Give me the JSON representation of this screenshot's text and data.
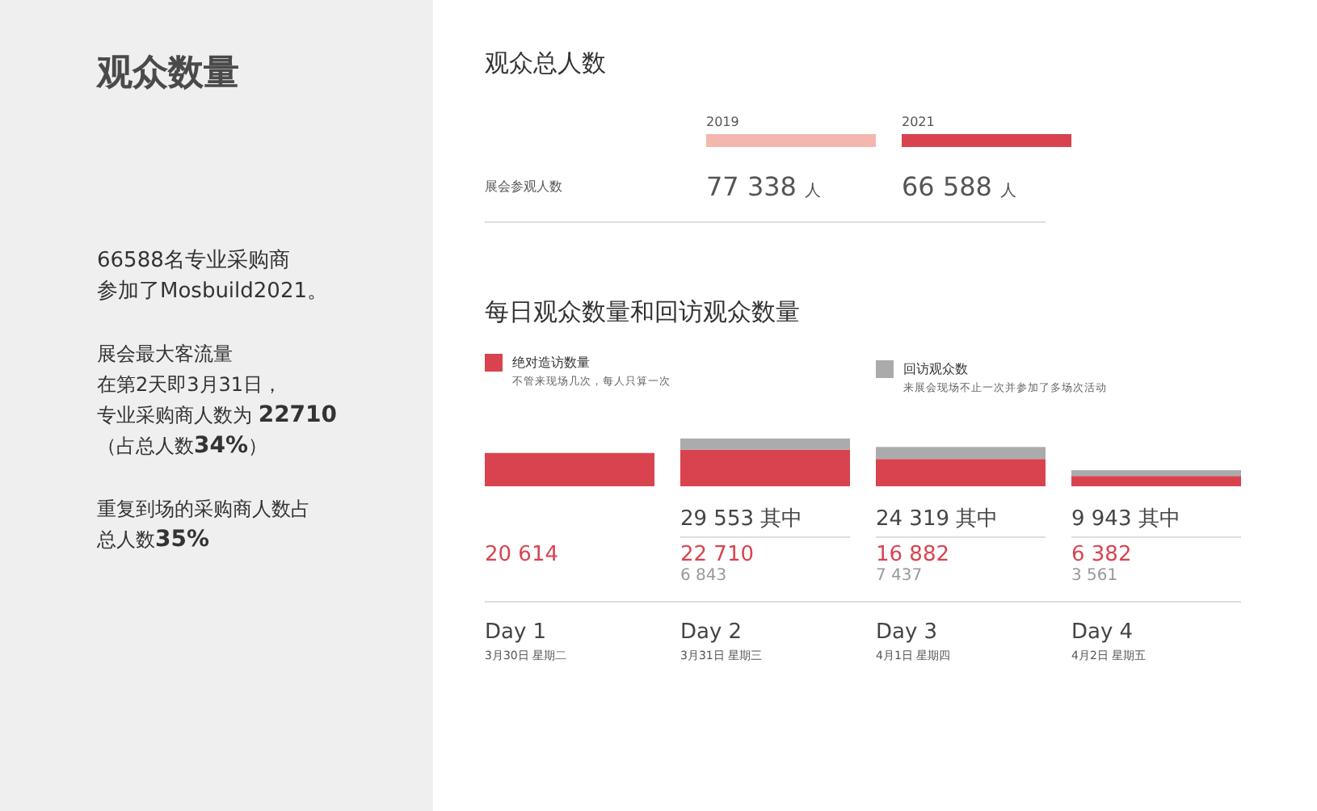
{
  "sidebar": {
    "title": "观众数量",
    "paragraphs": [
      [
        "66588名专业采购商",
        "参加了Mosbuild2021。"
      ],
      [
        "展会最大客流量",
        "在第2天即3月31日，",
        "专业采购商人数为 **22710**",
        "（占总人数**34%**）"
      ],
      [
        "重复到场的采购商人数占",
        "总人数**35%**"
      ]
    ]
  },
  "total": {
    "title": "观众总人数",
    "row_label": "展会参观人数",
    "years": [
      {
        "year": "2019",
        "value": "77 338",
        "unit": "人",
        "color": "#f3b7b0"
      },
      {
        "year": "2021",
        "value": "66 588",
        "unit": "人",
        "color": "#d9434f"
      }
    ]
  },
  "daily": {
    "title": "每日观众数量和回访观众数量",
    "legend_notes": [
      "不管来现场几次，每人只算一次",
      "来展会现场不止一次并参加了多场次活动"
    ],
    "chart_data": {
      "type": "bar",
      "stacked": true,
      "data_labels": true,
      "categories": [
        "Day 1",
        "Day 2",
        "Day 3",
        "Day 4"
      ],
      "series": [
        {
          "name": "绝对造访数量",
          "color": "#d9434f",
          "values": [
            20614,
            22710,
            16882,
            6382
          ]
        },
        {
          "name": "回访观众数",
          "color": "#ababad",
          "values": [
            null,
            6843,
            7437,
            3561
          ]
        }
      ]
    },
    "days": [
      {
        "date": "3月30日 星期二"
      },
      {
        "total": "29 553 其中",
        "date": "3月31日 星期三"
      },
      {
        "total": "24 319 其中",
        "date": "4月1日 星期四"
      },
      {
        "total": "9 943 其中",
        "date": "4月2日 星期五"
      }
    ]
  }
}
